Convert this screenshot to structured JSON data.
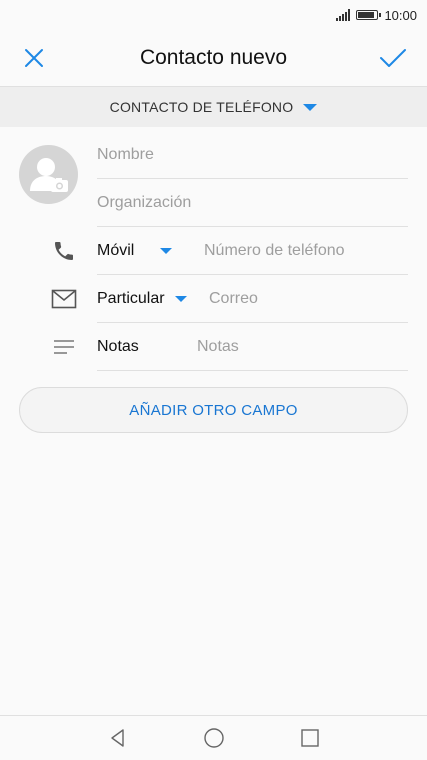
{
  "status": {
    "time": "10:00",
    "battery_level": 0.85
  },
  "header": {
    "title": "Contacto nuevo",
    "close_icon": "close-icon",
    "confirm_icon": "check-icon"
  },
  "account": {
    "label": "CONTACTO DE TELÉFONO"
  },
  "form": {
    "name_placeholder": "Nombre",
    "organization_placeholder": "Organización",
    "phone": {
      "type_label": "Móvil",
      "placeholder": "Número de teléfono"
    },
    "email": {
      "type_label": "Particular",
      "placeholder": "Correo"
    },
    "notes": {
      "label": "Notas",
      "placeholder": "Notas"
    }
  },
  "add_field": {
    "label": "AÑADIR OTRO CAMPO"
  },
  "colors": {
    "accent": "#1e88e5",
    "text": "#212121",
    "hint": "#9e9e9e"
  }
}
